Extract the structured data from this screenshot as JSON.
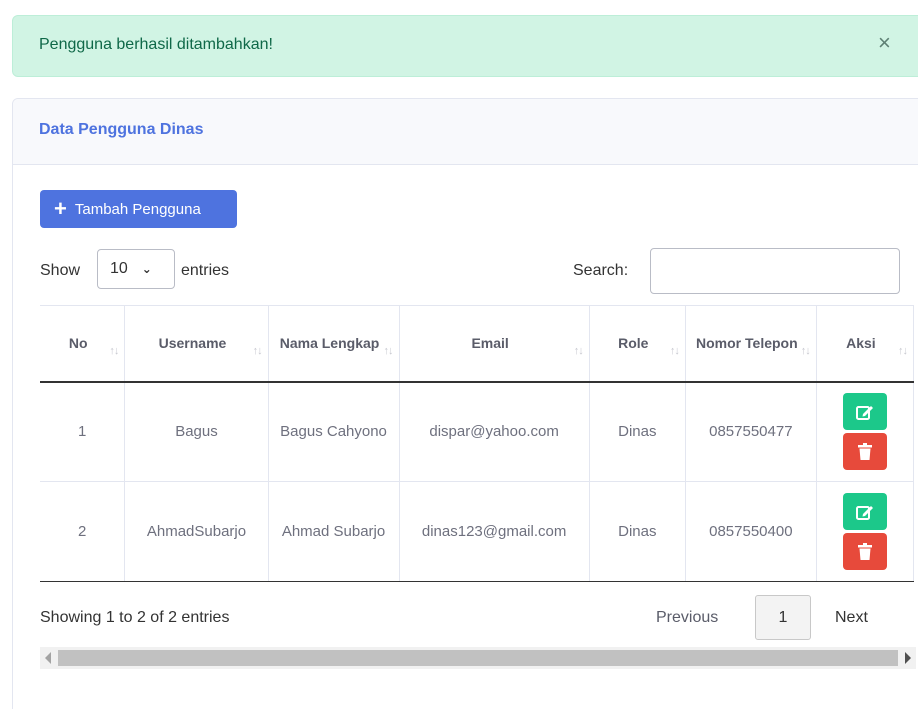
{
  "alert": {
    "message": "Pengguna berhasil ditambahkan!",
    "close": "×"
  },
  "card": {
    "title": "Data Pengguna Dinas"
  },
  "toolbar": {
    "add_label": "Tambah Pengguna",
    "add_icon": "plus-icon"
  },
  "length": {
    "show": "Show",
    "value": "10",
    "entries": "entries"
  },
  "search": {
    "label": "Search:",
    "value": ""
  },
  "table": {
    "headers": [
      "No",
      "Username",
      "Nama Lengkap",
      "Email",
      "Role",
      "Nomor Telepon",
      "Aksi"
    ],
    "sort_glyph": "↑↓",
    "rows": [
      [
        "1",
        "Bagus",
        "Bagus Cahyono",
        "dispar@yahoo.com",
        "Dinas",
        "0857550477"
      ],
      [
        "2",
        "AhmadSubarjo",
        "Ahmad Subarjo",
        "dinas123@gmail.com",
        "Dinas",
        "0857550400"
      ]
    ],
    "actions": {
      "edit_icon": "edit-icon",
      "delete_icon": "trash-icon"
    }
  },
  "info": "Showing 1 to 2 of 2 entries",
  "pagination": {
    "previous": "Previous",
    "current": "1",
    "next": "Next"
  },
  "colors": {
    "primary": "#4e73df",
    "success": "#1cc88a",
    "danger": "#e74a3b",
    "alert_bg": "#d1f4e4"
  }
}
